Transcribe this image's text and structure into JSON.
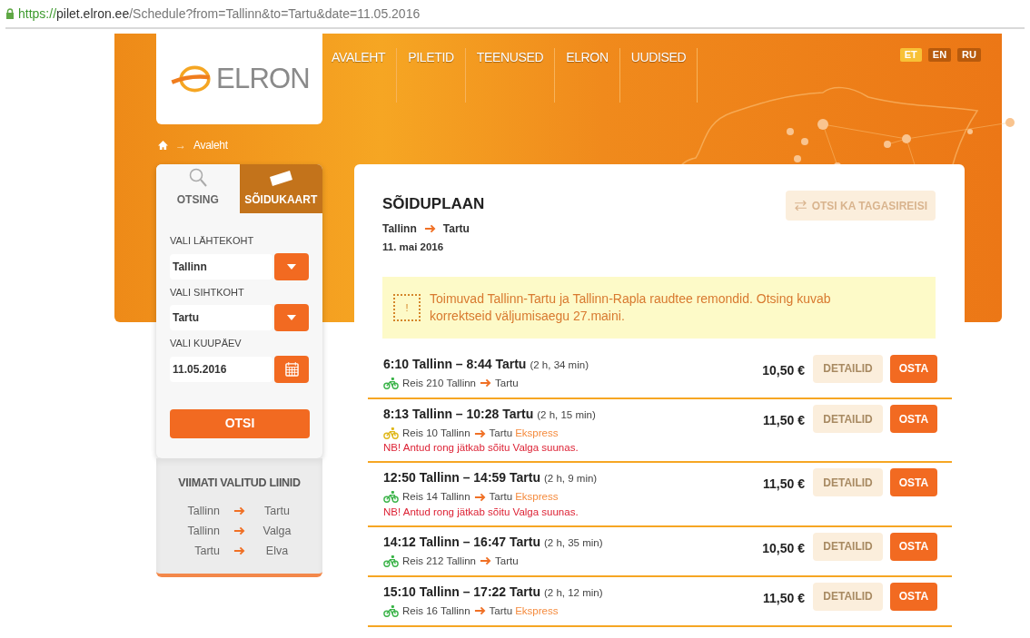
{
  "address_bar": {
    "scheme": "https://",
    "host": "pilet.elron.ee",
    "path": "/Schedule?from=Tallinn&to=Tartu&date=11.05.2016"
  },
  "logo": {
    "text": "ELRON"
  },
  "nav": [
    "AVALEHT",
    "PILETID",
    "TEENUSED",
    "ELRON",
    "UUDISED"
  ],
  "languages": [
    {
      "label": "ET",
      "selected": true
    },
    {
      "label": "EN",
      "selected": false
    },
    {
      "label": "RU",
      "selected": false
    }
  ],
  "breadcrumb_separator": "→",
  "breadcrumb": [
    "Avaleht"
  ],
  "sidebar": {
    "tabs": [
      {
        "label": "OTSING",
        "kind": "search",
        "selected": true
      },
      {
        "label": "SÕIDUKAART",
        "kind": "card",
        "selected": false
      }
    ],
    "fields": [
      {
        "label": "VALI LÄHTEKOHT",
        "value": "Tallinn",
        "kind": "select"
      },
      {
        "label": "VALI SIHTKOHT",
        "value": "Tartu",
        "kind": "select"
      },
      {
        "label": "VALI KUUPÄEV",
        "value": "11.05.2016",
        "kind": "date"
      }
    ],
    "submit": "OTSI",
    "recent_title": "VIIMATI VALITUD LIINID",
    "recent": [
      {
        "from": "Tallinn",
        "to": "Tartu"
      },
      {
        "from": "Tallinn",
        "to": "Valga"
      },
      {
        "from": "Tartu",
        "to": "Elva"
      }
    ]
  },
  "schedule": {
    "title": "SÕIDUPLAAN",
    "from": "Tallinn",
    "to": "Tartu",
    "date": "11. mai 2016",
    "return_button": "OTSI KA TAGASIREISI",
    "notice": "Toimuvad Tallinn-Tartu ja Tallinn-Rapla raudtee remondid. Otsing kuvab korrektseid väljumisaegu 27.maini.",
    "notice_icon": "!",
    "trips": [
      {
        "title": "6:10 Tallinn – 8:44 Tartu",
        "duration": "(2 h, 34 min)",
        "train": "Reis 210 Tallinn",
        "dest": "Tartu",
        "color": "#3cb44a",
        "price": "10,50 €",
        "details": "DETAILID",
        "buy": "OSTA"
      },
      {
        "title": "8:13 Tallinn – 10:28 Tartu",
        "duration": "(2 h, 15 min)",
        "train": "Reis 10 Tallinn",
        "dest": "Tartu",
        "express": "Ekspress",
        "note": "NB! Antud rong jätkab sõitu Valga suunas.",
        "color": "#e0b81c",
        "price": "11,50 €",
        "details": "DETAILID",
        "buy": "OSTA"
      },
      {
        "title": "12:50 Tallinn – 14:59 Tartu",
        "duration": "(2 h, 9 min)",
        "train": "Reis 14 Tallinn",
        "dest": "Tartu",
        "express": "Ekspress",
        "note": "NB! Antud rong jätkab sõitu Valga suunas.",
        "color": "#3cb44a",
        "price": "11,50 €",
        "details": "DETAILID",
        "buy": "OSTA"
      },
      {
        "title": "14:12 Tallinn – 16:47 Tartu",
        "duration": "(2 h, 35 min)",
        "train": "Reis 212 Tallinn",
        "dest": "Tartu",
        "color": "#3cb44a",
        "price": "10,50 €",
        "details": "DETAILID",
        "buy": "OSTA"
      },
      {
        "title": "15:10 Tallinn – 17:22 Tartu",
        "duration": "(2 h, 12 min)",
        "train": "Reis 16 Tallinn",
        "dest": "Tartu",
        "express": "Ekspress",
        "color": "#3cb44a",
        "price": "11,50 €",
        "details": "DETAILID",
        "buy": "OSTA"
      }
    ]
  }
}
